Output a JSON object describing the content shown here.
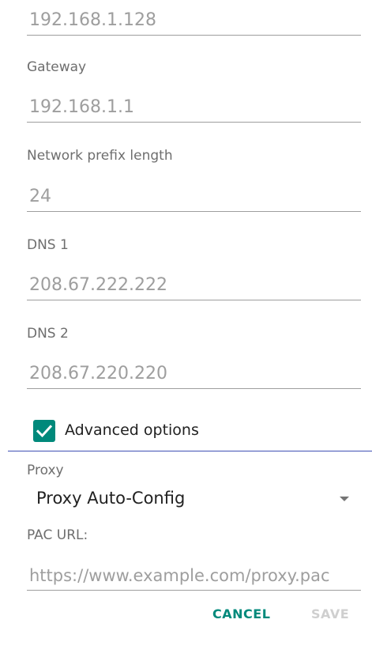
{
  "fields": {
    "ip_address_value": "192.168.1.128",
    "gateway_label": "Gateway",
    "gateway_value": "192.168.1.1",
    "prefix_label": "Network prefix length",
    "prefix_value": "24",
    "dns1_label": "DNS 1",
    "dns1_value": "208.67.222.222",
    "dns2_label": "DNS 2",
    "dns2_value": "208.67.220.220"
  },
  "advanced": {
    "label": "Advanced options",
    "checked": true
  },
  "proxy": {
    "label": "Proxy",
    "selected": "Proxy Auto-Config",
    "pac_label": "PAC URL:",
    "pac_placeholder": "https://www.example.com/proxy.pac"
  },
  "buttons": {
    "cancel": "CANCEL",
    "save": "SAVE"
  },
  "colors": {
    "accent": "#00897b",
    "divider": "#3f51b5",
    "disabled": "#cfcfcf"
  }
}
